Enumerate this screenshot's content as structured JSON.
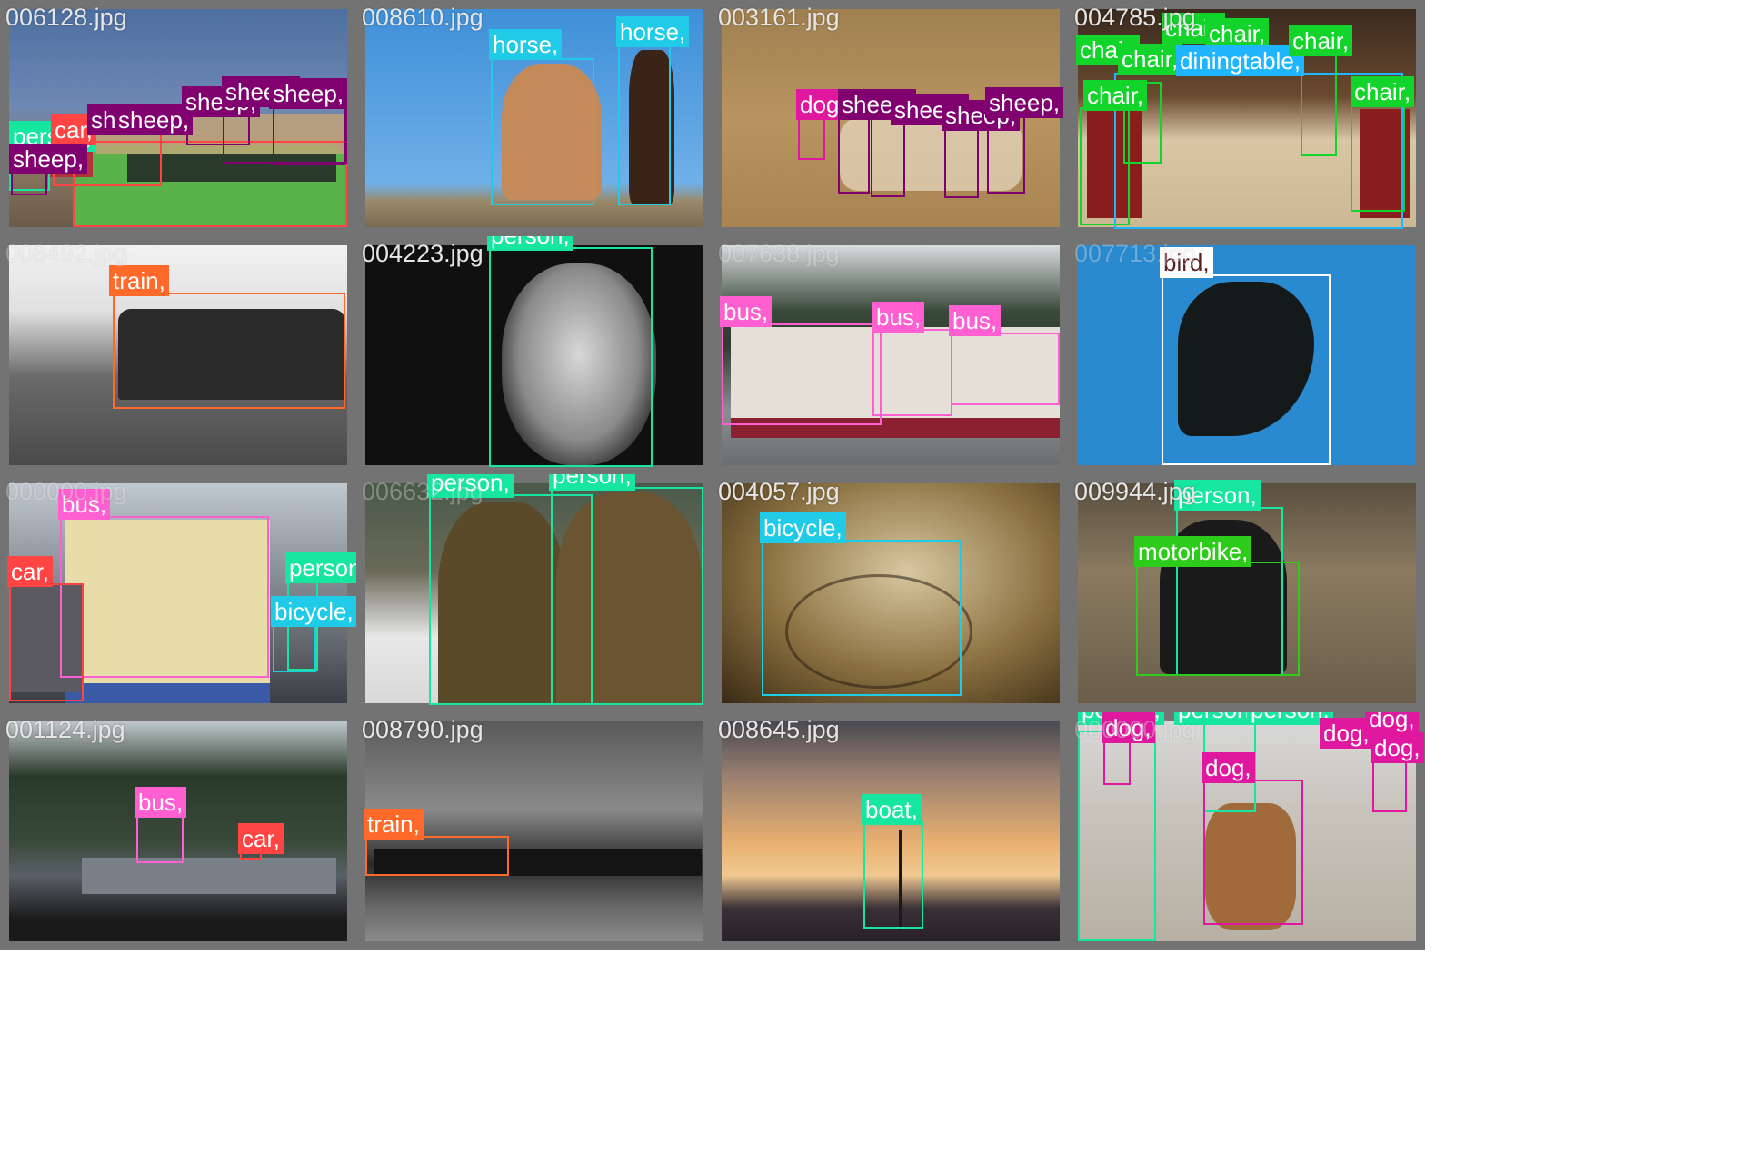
{
  "colors": {
    "sheep": "#800070",
    "person": "#17e6a0",
    "car": "#ff4444",
    "horse": "#1fcbe6",
    "dog": "#e0179f",
    "chair": "#13d42a",
    "diningtable": "#1fb6ff",
    "train": "#ff6a2b",
    "bus": "#ff5fd0",
    "bird": "#ffffff",
    "bicycle": "#1fcbe6",
    "motorbike": "#2ecc1a",
    "boat": "#17e6a0"
  },
  "tiles": [
    {
      "file": "006128.jpg",
      "labels": [
        "sheep,",
        "sheep,",
        "sheep,",
        "sheep,",
        "sheep,",
        "car,",
        "person,",
        "sheep,"
      ]
    },
    {
      "file": "008610.jpg",
      "labels": [
        "horse,",
        "horse,"
      ]
    },
    {
      "file": "003161.jpg",
      "labels": [
        "dog,",
        "sheep,",
        "sheep,",
        "sheep,",
        "sheep,"
      ]
    },
    {
      "file": "004785.jpg",
      "labels": [
        "chair,",
        "chair,",
        "chair,",
        "chair,",
        "chair,",
        "chair,",
        "chair,",
        "diningtable,"
      ]
    },
    {
      "file": "008492.jpg",
      "labels": [
        "train,"
      ]
    },
    {
      "file": "004223.jpg",
      "labels": [
        "person,"
      ]
    },
    {
      "file": "007638.jpg",
      "labels": [
        "bus,",
        "bus,",
        "bus,"
      ]
    },
    {
      "file": "007713.jpg",
      "labels": [
        "bird,"
      ]
    },
    {
      "file": "000000.jpg",
      "labels": [
        "bus,",
        "car,",
        "person,",
        "bicycle,"
      ]
    },
    {
      "file": "006632.jpg",
      "labels": [
        "person,",
        "person,"
      ]
    },
    {
      "file": "004057.jpg",
      "labels": [
        "bicycle,"
      ]
    },
    {
      "file": "009944.jpg",
      "labels": [
        "person,",
        "motorbike,"
      ]
    },
    {
      "file": "001124.jpg",
      "labels": [
        "bus,",
        "car,"
      ]
    },
    {
      "file": "008790.jpg",
      "labels": [
        "train,"
      ]
    },
    {
      "file": "008645.jpg",
      "labels": [
        "boat,"
      ]
    },
    {
      "file": "000000.jpg",
      "labels": [
        "person,",
        "person,",
        "person,",
        "person,",
        "dog,",
        "dog,",
        "dog,",
        "dog,",
        "dog,"
      ]
    }
  ]
}
